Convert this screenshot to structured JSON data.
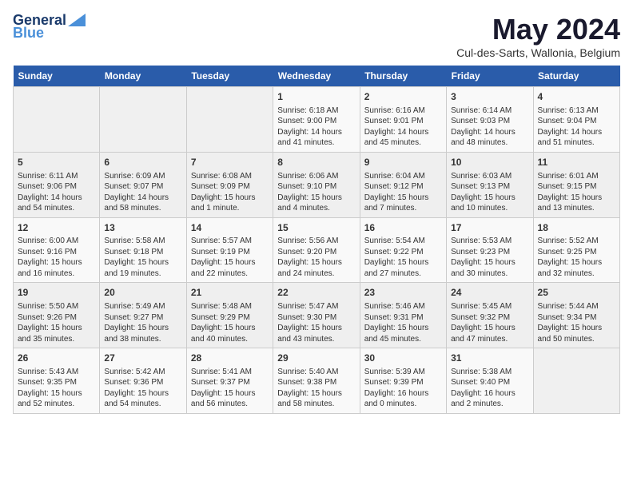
{
  "logo": {
    "general": "General",
    "blue": "Blue"
  },
  "title": "May 2024",
  "subtitle": "Cul-des-Sarts, Wallonia, Belgium",
  "days_header": [
    "Sunday",
    "Monday",
    "Tuesday",
    "Wednesday",
    "Thursday",
    "Friday",
    "Saturday"
  ],
  "weeks": [
    [
      {
        "day": "",
        "info": ""
      },
      {
        "day": "",
        "info": ""
      },
      {
        "day": "",
        "info": ""
      },
      {
        "day": "1",
        "info": "Sunrise: 6:18 AM\nSunset: 9:00 PM\nDaylight: 14 hours\nand 41 minutes."
      },
      {
        "day": "2",
        "info": "Sunrise: 6:16 AM\nSunset: 9:01 PM\nDaylight: 14 hours\nand 45 minutes."
      },
      {
        "day": "3",
        "info": "Sunrise: 6:14 AM\nSunset: 9:03 PM\nDaylight: 14 hours\nand 48 minutes."
      },
      {
        "day": "4",
        "info": "Sunrise: 6:13 AM\nSunset: 9:04 PM\nDaylight: 14 hours\nand 51 minutes."
      }
    ],
    [
      {
        "day": "5",
        "info": "Sunrise: 6:11 AM\nSunset: 9:06 PM\nDaylight: 14 hours\nand 54 minutes."
      },
      {
        "day": "6",
        "info": "Sunrise: 6:09 AM\nSunset: 9:07 PM\nDaylight: 14 hours\nand 58 minutes."
      },
      {
        "day": "7",
        "info": "Sunrise: 6:08 AM\nSunset: 9:09 PM\nDaylight: 15 hours\nand 1 minute."
      },
      {
        "day": "8",
        "info": "Sunrise: 6:06 AM\nSunset: 9:10 PM\nDaylight: 15 hours\nand 4 minutes."
      },
      {
        "day": "9",
        "info": "Sunrise: 6:04 AM\nSunset: 9:12 PM\nDaylight: 15 hours\nand 7 minutes."
      },
      {
        "day": "10",
        "info": "Sunrise: 6:03 AM\nSunset: 9:13 PM\nDaylight: 15 hours\nand 10 minutes."
      },
      {
        "day": "11",
        "info": "Sunrise: 6:01 AM\nSunset: 9:15 PM\nDaylight: 15 hours\nand 13 minutes."
      }
    ],
    [
      {
        "day": "12",
        "info": "Sunrise: 6:00 AM\nSunset: 9:16 PM\nDaylight: 15 hours\nand 16 minutes."
      },
      {
        "day": "13",
        "info": "Sunrise: 5:58 AM\nSunset: 9:18 PM\nDaylight: 15 hours\nand 19 minutes."
      },
      {
        "day": "14",
        "info": "Sunrise: 5:57 AM\nSunset: 9:19 PM\nDaylight: 15 hours\nand 22 minutes."
      },
      {
        "day": "15",
        "info": "Sunrise: 5:56 AM\nSunset: 9:20 PM\nDaylight: 15 hours\nand 24 minutes."
      },
      {
        "day": "16",
        "info": "Sunrise: 5:54 AM\nSunset: 9:22 PM\nDaylight: 15 hours\nand 27 minutes."
      },
      {
        "day": "17",
        "info": "Sunrise: 5:53 AM\nSunset: 9:23 PM\nDaylight: 15 hours\nand 30 minutes."
      },
      {
        "day": "18",
        "info": "Sunrise: 5:52 AM\nSunset: 9:25 PM\nDaylight: 15 hours\nand 32 minutes."
      }
    ],
    [
      {
        "day": "19",
        "info": "Sunrise: 5:50 AM\nSunset: 9:26 PM\nDaylight: 15 hours\nand 35 minutes."
      },
      {
        "day": "20",
        "info": "Sunrise: 5:49 AM\nSunset: 9:27 PM\nDaylight: 15 hours\nand 38 minutes."
      },
      {
        "day": "21",
        "info": "Sunrise: 5:48 AM\nSunset: 9:29 PM\nDaylight: 15 hours\nand 40 minutes."
      },
      {
        "day": "22",
        "info": "Sunrise: 5:47 AM\nSunset: 9:30 PM\nDaylight: 15 hours\nand 43 minutes."
      },
      {
        "day": "23",
        "info": "Sunrise: 5:46 AM\nSunset: 9:31 PM\nDaylight: 15 hours\nand 45 minutes."
      },
      {
        "day": "24",
        "info": "Sunrise: 5:45 AM\nSunset: 9:32 PM\nDaylight: 15 hours\nand 47 minutes."
      },
      {
        "day": "25",
        "info": "Sunrise: 5:44 AM\nSunset: 9:34 PM\nDaylight: 15 hours\nand 50 minutes."
      }
    ],
    [
      {
        "day": "26",
        "info": "Sunrise: 5:43 AM\nSunset: 9:35 PM\nDaylight: 15 hours\nand 52 minutes."
      },
      {
        "day": "27",
        "info": "Sunrise: 5:42 AM\nSunset: 9:36 PM\nDaylight: 15 hours\nand 54 minutes."
      },
      {
        "day": "28",
        "info": "Sunrise: 5:41 AM\nSunset: 9:37 PM\nDaylight: 15 hours\nand 56 minutes."
      },
      {
        "day": "29",
        "info": "Sunrise: 5:40 AM\nSunset: 9:38 PM\nDaylight: 15 hours\nand 58 minutes."
      },
      {
        "day": "30",
        "info": "Sunrise: 5:39 AM\nSunset: 9:39 PM\nDaylight: 16 hours\nand 0 minutes."
      },
      {
        "day": "31",
        "info": "Sunrise: 5:38 AM\nSunset: 9:40 PM\nDaylight: 16 hours\nand 2 minutes."
      },
      {
        "day": "",
        "info": ""
      }
    ]
  ]
}
